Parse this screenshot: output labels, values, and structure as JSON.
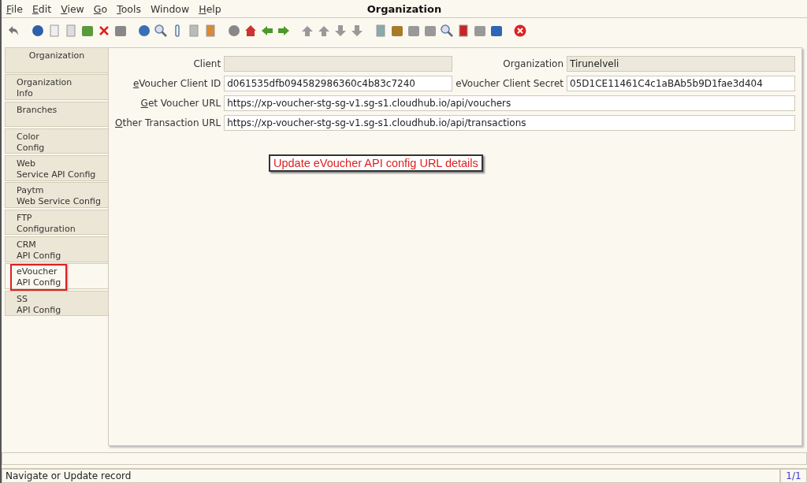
{
  "menu": [
    {
      "label": "File",
      "mnemonic": true
    },
    {
      "label": "Edit",
      "mnemonic": true
    },
    {
      "label": "View",
      "mnemonic": true
    },
    {
      "label": "Go",
      "mnemonic": true
    },
    {
      "label": "Tools",
      "mnemonic": true
    },
    {
      "label": "Window",
      "mnemonic": false
    },
    {
      "label": "Help",
      "mnemonic": true
    }
  ],
  "window": {
    "title": "Organization"
  },
  "tabs": [
    {
      "lines": [
        "Organization"
      ],
      "selected": false,
      "highlighted": false
    },
    {
      "lines": [
        "Organization",
        "Info"
      ],
      "selected": false,
      "highlighted": false
    },
    {
      "lines": [
        "Branches"
      ],
      "selected": false,
      "highlighted": false
    },
    {
      "lines": [
        "Color",
        "Config"
      ],
      "selected": false,
      "highlighted": false
    },
    {
      "lines": [
        "Web",
        "Service API Config"
      ],
      "selected": false,
      "highlighted": false
    },
    {
      "lines": [
        "Paytm",
        "Web Service Config"
      ],
      "selected": false,
      "highlighted": false
    },
    {
      "lines": [
        "FTP",
        "Configuration"
      ],
      "selected": false,
      "highlighted": false
    },
    {
      "lines": [
        "CRM",
        "API Config"
      ],
      "selected": false,
      "highlighted": false
    },
    {
      "lines": [
        "eVoucher",
        "API Config"
      ],
      "selected": true,
      "highlighted": true
    },
    {
      "lines": [
        "SS",
        "API Config"
      ],
      "selected": false,
      "highlighted": false
    }
  ],
  "form": [
    [
      {
        "label": "Client",
        "mnemonic": false,
        "readonly": true
      },
      {
        "label": "Organization",
        "mnemonic": false,
        "value": "Tirunelveli",
        "readonly": true
      }
    ],
    [
      {
        "label": "eVoucher Client ID",
        "mnemonic": true,
        "value": "d061535dfb094582986360c4b83c7240",
        "readonly": false
      },
      {
        "label": "eVoucher Client Secret",
        "mnemonic": false,
        "value": "05D1CE11461C4c1aBAb5b9D1fae3d404",
        "readonly": false
      }
    ],
    [
      {
        "label": "Get Voucher URL",
        "mnemonic": true,
        "value": "https://xp-voucher-stg-sg-v1.sg-s1.cloudhub.io/api/vouchers",
        "readonly": false
      }
    ],
    [
      {
        "label": "Other Transaction URL",
        "mnemonic": true,
        "value": "https://xp-voucher-stg-sg-v1.sg-s1.cloudhub.io/api/transactions",
        "readonly": false
      }
    ]
  ],
  "callout": "Update eVoucher API config URL details",
  "status_bar": {
    "message": "Navigate or Update record",
    "record": "1/1"
  }
}
